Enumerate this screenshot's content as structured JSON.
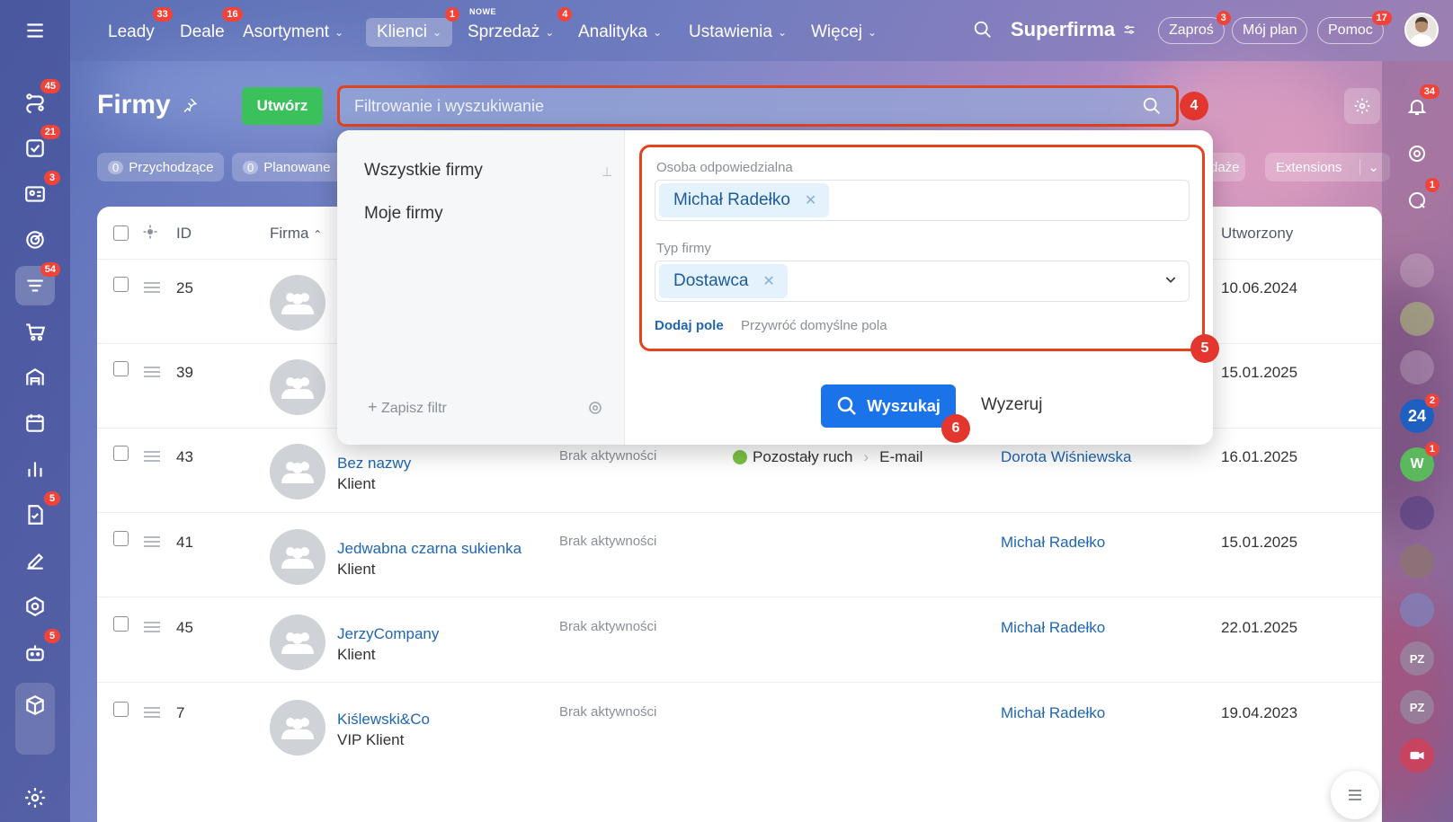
{
  "nav": {
    "items": [
      {
        "label": "Leady",
        "badge": "33"
      },
      {
        "label": "Deale",
        "badge": "16"
      },
      {
        "label": "Asortyment"
      },
      {
        "label": "Klienci",
        "badge": "1"
      },
      {
        "label": "Sprzedaż",
        "badge": "4",
        "tag": "NOWE"
      },
      {
        "label": "Analityka"
      },
      {
        "label": "Ustawienia"
      },
      {
        "label": "Więcej"
      }
    ],
    "brand": "Superfirma",
    "invite": "Zaproś",
    "invite_badge": "3",
    "plan": "Mój plan",
    "help": "Pomoc",
    "help_badge": "17"
  },
  "left_badges": [
    "45",
    "21",
    "3",
    "54",
    "5",
    "5"
  ],
  "page": {
    "title": "Firmy",
    "create": "Utwórz",
    "search_placeholder": "Filtrowanie i wyszukiwanie",
    "callout_4": "4",
    "callout_5": "5",
    "callout_6": "6"
  },
  "chips": {
    "incoming_count": "0",
    "incoming": "Przychodzące",
    "planned_count": "0",
    "planned": "Planowane",
    "sales_tail": "daże",
    "extensions": "Extensions"
  },
  "table": {
    "headers": {
      "id": "ID",
      "company": "Firma",
      "created": "Utworzony"
    },
    "rows": [
      {
        "id": "25",
        "name": "",
        "type": "",
        "activity": "",
        "responsible": "",
        "created": "10.06.2024"
      },
      {
        "id": "39",
        "name": "",
        "type": "",
        "activity": "",
        "responsible": "",
        "created": "15.01.2025"
      },
      {
        "id": "43",
        "name": "Bez nazwy",
        "type": "Klient",
        "activity": "Brak aktywności",
        "source": "Pozostały ruch",
        "source_sub": "E-mail",
        "responsible": "Dorota Wiśniewska",
        "created": "16.01.2025"
      },
      {
        "id": "41",
        "name": "Jedwabna czarna sukienka",
        "type": "Klient",
        "activity": "Brak aktywności",
        "responsible": "Michał Radełko",
        "created": "15.01.2025"
      },
      {
        "id": "45",
        "name": "JerzyCompany",
        "type": "Klient",
        "activity": "Brak aktywności",
        "responsible": "Michał Radełko",
        "created": "22.01.2025"
      },
      {
        "id": "7",
        "name": "Kiślewski&Co",
        "type": "VIP Klient",
        "activity": "Brak aktywności",
        "responsible": "Michał Radełko",
        "created": "19.04.2023"
      }
    ]
  },
  "popup": {
    "presets": [
      "Wszystkie firmy",
      "Moje firmy"
    ],
    "save_filter": "Zapisz filtr",
    "field1_label": "Osoba odpowiedzialna",
    "field1_value": "Michał Radełko",
    "field2_label": "Typ firmy",
    "field2_value": "Dostawca",
    "add_field": "Dodaj pole",
    "restore": "Przywróć domyślne pola",
    "search": "Wyszukaj",
    "reset": "Wyzeruj"
  },
  "right_bar": {
    "bell_badge": "34",
    "chat_badge": "1",
    "app24": "24",
    "app24_badge": "2",
    "w": "W",
    "w_badge": "1",
    "pz1": "PZ",
    "pz2": "PZ"
  },
  "colors": {
    "accent": "#1a73e8",
    "create": "#3bc15c",
    "highlight": "#e2431d",
    "badge": "#f0443a"
  }
}
